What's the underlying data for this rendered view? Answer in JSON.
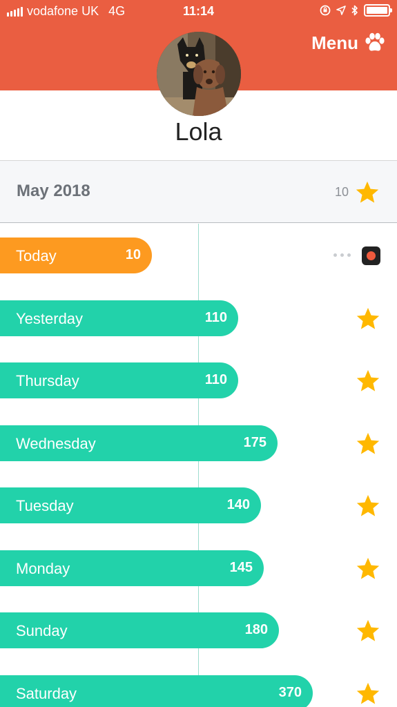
{
  "status_bar": {
    "carrier": "vodafone UK",
    "network": "4G",
    "time": "11:14"
  },
  "header": {
    "menu_label": "Menu",
    "menu_icon": "paw-icon",
    "background_color": "#ea5e41"
  },
  "profile": {
    "name": "Lola"
  },
  "month": {
    "label": "May 2018",
    "stars": "10"
  },
  "days": [
    {
      "label": "Today",
      "value": "10",
      "color": "#fd9a20",
      "star": false
    },
    {
      "label": "Yesterday",
      "value": "110",
      "color": "#22d2aa",
      "star": true
    },
    {
      "label": "Thursday",
      "value": "110",
      "color": "#22d2aa",
      "star": true
    },
    {
      "label": "Wednesday",
      "value": "175",
      "color": "#22d2aa",
      "star": true
    },
    {
      "label": "Tuesday",
      "value": "140",
      "color": "#22d2aa",
      "star": true
    },
    {
      "label": "Monday",
      "value": "145",
      "color": "#22d2aa",
      "star": true
    },
    {
      "label": "Sunday",
      "value": "180",
      "color": "#22d2aa",
      "star": true
    },
    {
      "label": "Saturday",
      "value": "370",
      "color": "#22d2aa",
      "star": true
    }
  ],
  "colors": {
    "star": "#ffb800",
    "record": "#ef5a3d"
  }
}
